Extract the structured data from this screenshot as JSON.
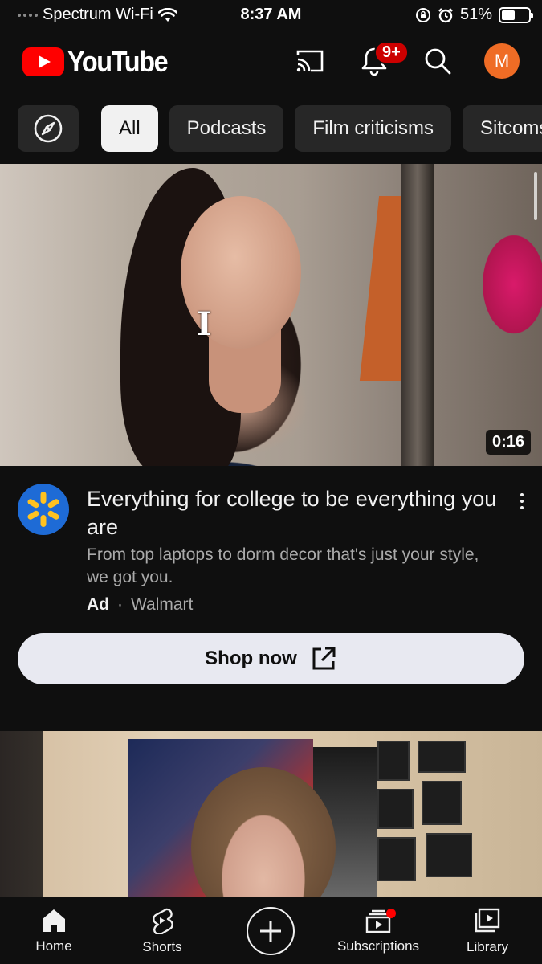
{
  "status_bar": {
    "carrier": "Spectrum Wi-Fi",
    "time": "8:37 AM",
    "battery_percent": "51%",
    "battery_level": 0.51
  },
  "header": {
    "app_name": "YouTube",
    "notification_count": "9+",
    "avatar_initial": "M",
    "brand_color": "#ff0000",
    "avatar_color": "#ef6c25"
  },
  "chips": [
    {
      "label": "All",
      "active": true
    },
    {
      "label": "Podcasts",
      "active": false
    },
    {
      "label": "Film criticisms",
      "active": false
    },
    {
      "label": "Sitcoms",
      "active": false
    }
  ],
  "ad_video": {
    "duration": "0:16",
    "title": "Everything for college to be everything you are",
    "description": "From top laptops to dorm decor that's just your style, we got you.",
    "ad_label": "Ad",
    "separator": "·",
    "advertiser": "Walmart",
    "cta_label": "Shop now"
  },
  "tabs": {
    "home": "Home",
    "shorts": "Shorts",
    "subscriptions": "Subscriptions",
    "library": "Library"
  },
  "icons": {
    "explore": "compass-icon",
    "cast": "cast-icon",
    "notifications": "bell-icon",
    "search": "search-icon",
    "more": "more-vertical-icon",
    "external": "open-external-icon",
    "home": "home-icon",
    "shorts": "shorts-icon",
    "create": "plus-icon",
    "subscriptions": "subscriptions-icon",
    "library": "library-icon"
  }
}
